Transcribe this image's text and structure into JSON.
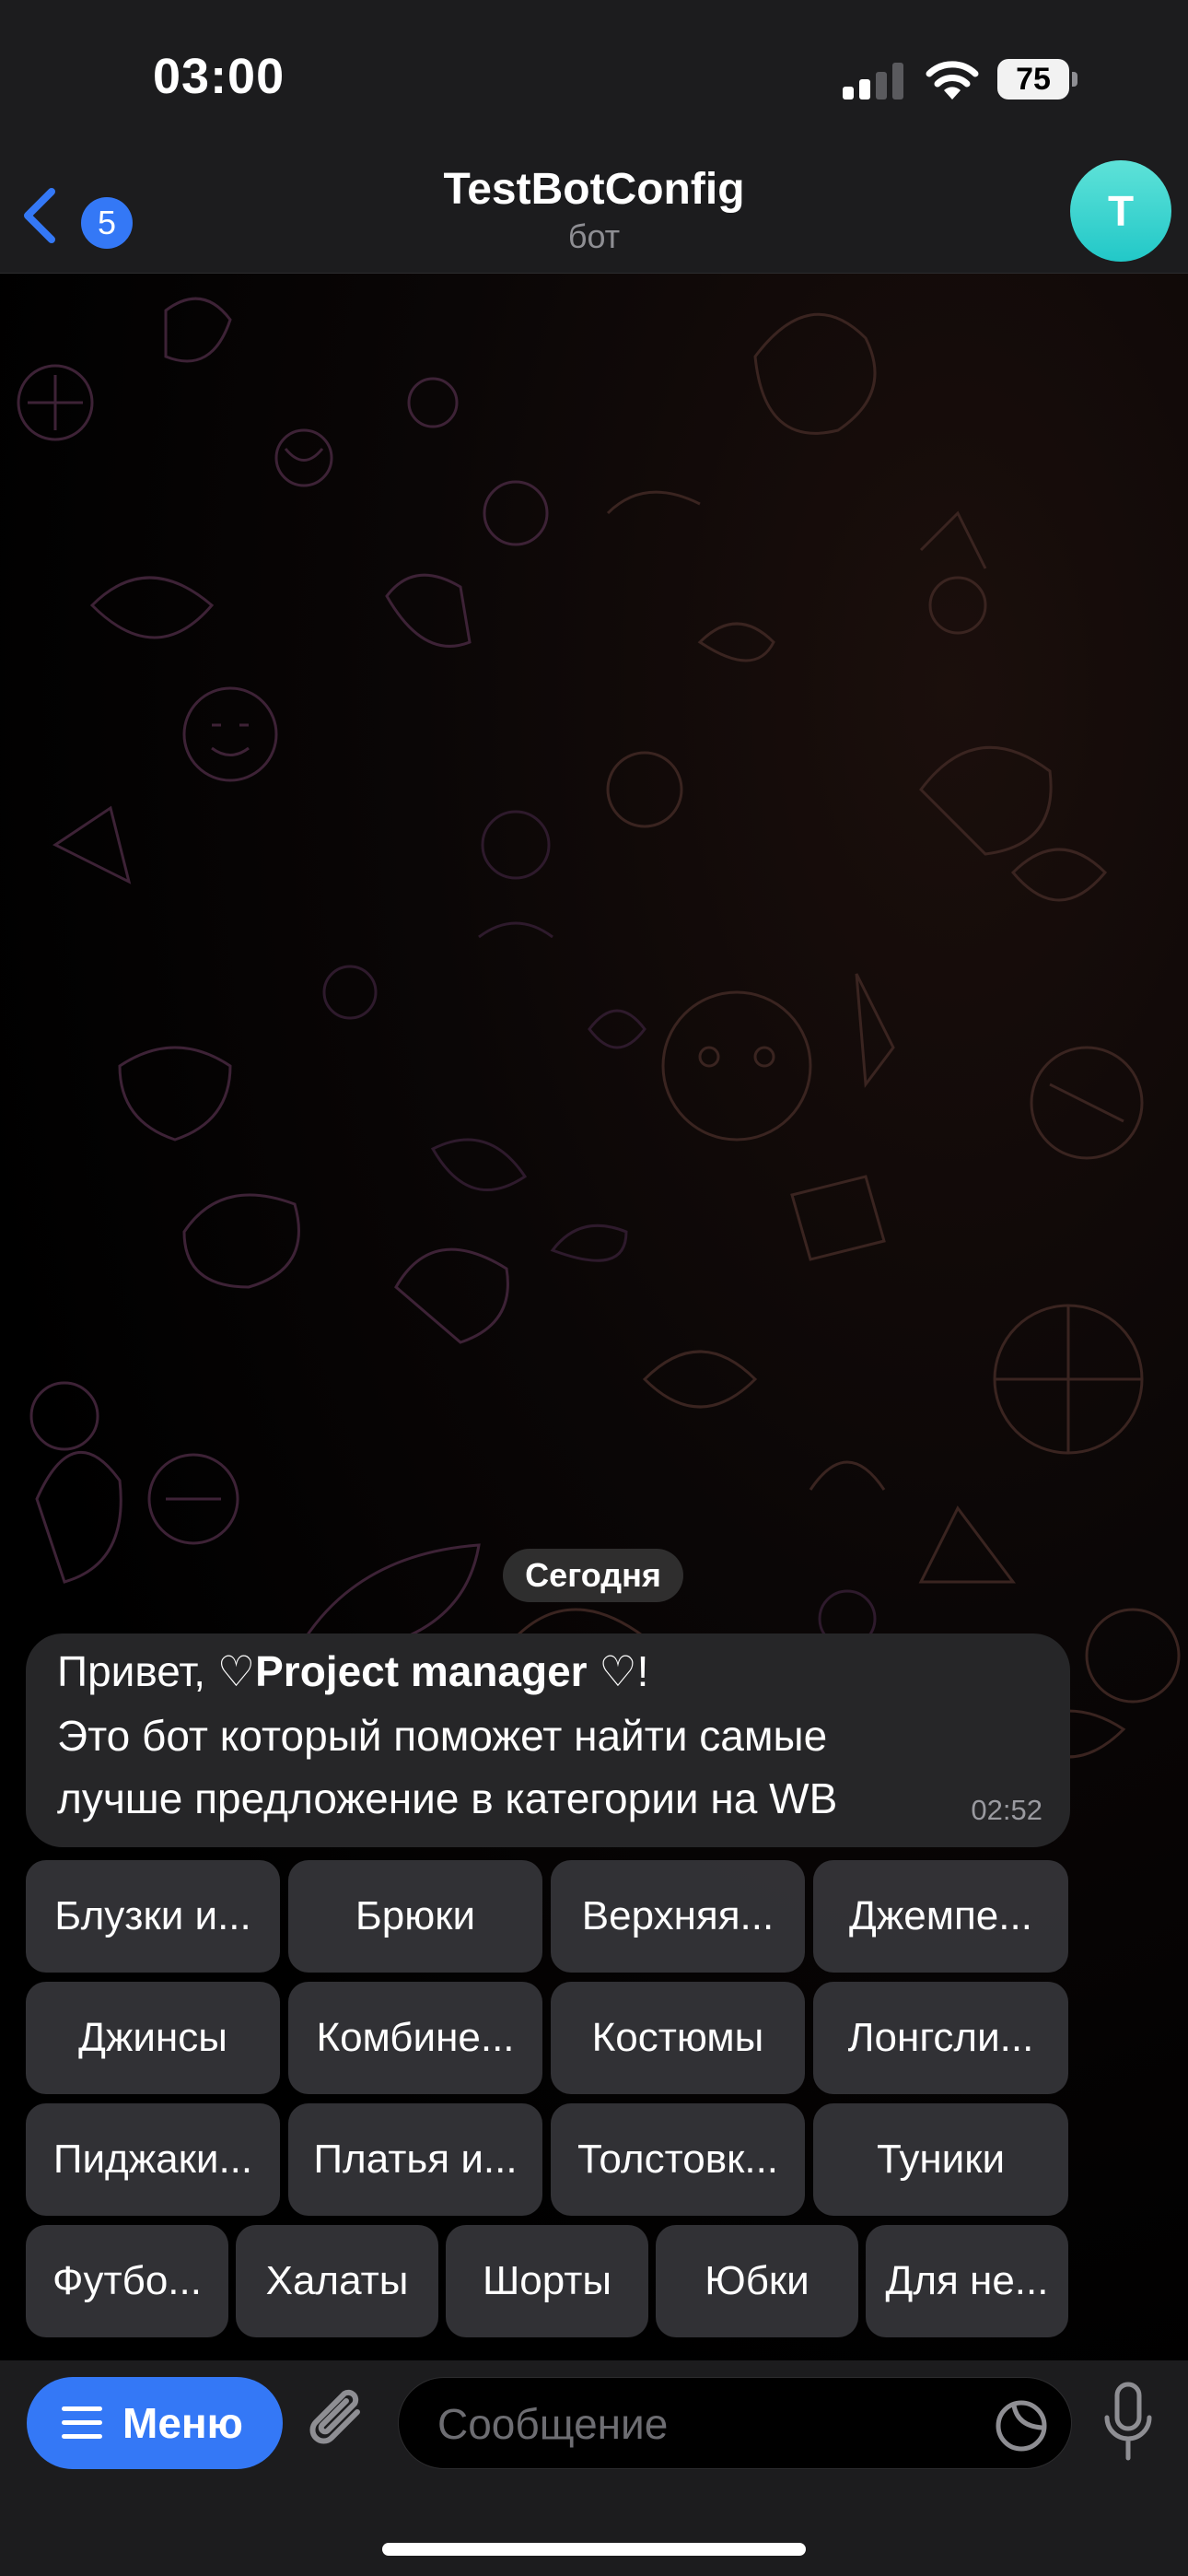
{
  "status_bar": {
    "time": "03:00",
    "battery": "75",
    "icons": [
      "signal-icon",
      "wifi-icon",
      "battery-icon"
    ]
  },
  "nav": {
    "back_badge": "5",
    "title": "TestBotConfig",
    "subtitle": "бот",
    "avatar_letter": "T",
    "accent_color": "#3478f6",
    "avatar_color": "#2bcfcf"
  },
  "chat": {
    "date_separator": "Сегодня",
    "message": {
      "greeting_prefix": "Привет, ",
      "heart_left": "♡",
      "name": "Project manager",
      "heart_right": " ♡!",
      "line2": "Это бот который поможет найти самые",
      "line3": "лучше предложение в категории на WB",
      "time": "02:52"
    },
    "keyboard": [
      [
        "Блузки и...",
        "Брюки",
        "Верхняя...",
        "Джемпе..."
      ],
      [
        "Джинсы",
        "Комбине...",
        "Костюмы",
        "Лонгсли..."
      ],
      [
        "Пиджаки...",
        "Платья и...",
        "Толстовк...",
        "Туники"
      ],
      [
        "Футбо...",
        "Халаты",
        "Шорты",
        "Юбки",
        "Для не..."
      ]
    ]
  },
  "input_bar": {
    "menu_label": "Меню",
    "placeholder": "Сообщение",
    "icons": [
      "menu-icon",
      "attach-icon",
      "sticker-icon",
      "mic-icon"
    ]
  }
}
